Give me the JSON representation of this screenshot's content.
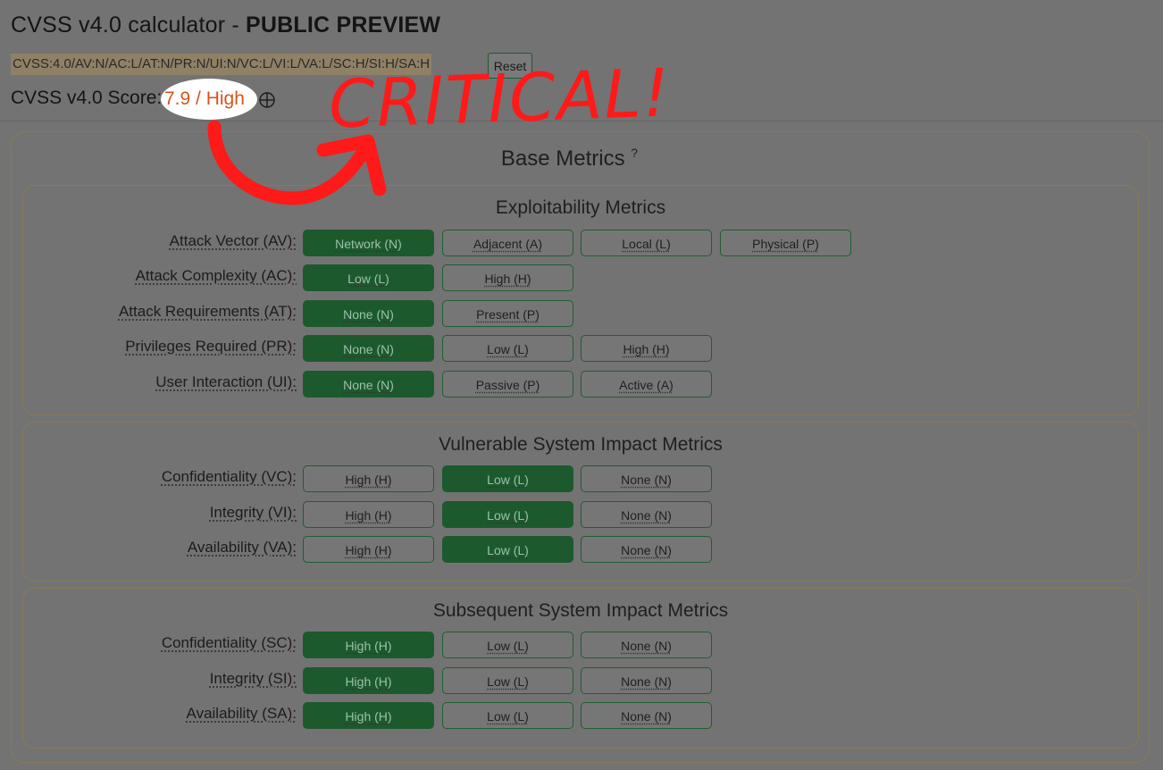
{
  "title": {
    "main": "CVSS v4.0 calculator - ",
    "emphasis": "PUBLIC PREVIEW"
  },
  "vector_string": "CVSS:4.0/AV:N/AC:L/AT:N/PR:N/UI:N/VC:L/VI:L/VA:L/SC:H/SI:H/SA:H",
  "reset_label": "Reset",
  "score": {
    "label": "CVSS v4.0 Score: ",
    "value": "7.9 / High",
    "value_color": "#d6541d"
  },
  "annotation": {
    "text": "CRITICAL!",
    "color": "#ff1a1a",
    "highlight_color": "#ffffff"
  },
  "colors": {
    "selected": "#1c5a2e",
    "overlay_background": "#737373",
    "border": "#8a7a55"
  },
  "base_metrics": {
    "title": "Base Metrics",
    "help": "?",
    "sections": [
      {
        "title": "Exploitability Metrics",
        "metrics": [
          {
            "label": "Attack Vector (AV):",
            "options": [
              "Network (N)",
              "Adjacent (A)",
              "Local (L)",
              "Physical (P)"
            ],
            "selected": 0
          },
          {
            "label": "Attack Complexity (AC):",
            "options": [
              "Low (L)",
              "High (H)"
            ],
            "selected": 0
          },
          {
            "label": "Attack Requirements (AT):",
            "options": [
              "None (N)",
              "Present (P)"
            ],
            "selected": 0
          },
          {
            "label": "Privileges Required (PR):",
            "options": [
              "None (N)",
              "Low (L)",
              "High (H)"
            ],
            "selected": 0
          },
          {
            "label": "User Interaction (UI):",
            "options": [
              "None (N)",
              "Passive (P)",
              "Active (A)"
            ],
            "selected": 0
          }
        ]
      },
      {
        "title": "Vulnerable System Impact Metrics",
        "metrics": [
          {
            "label": "Confidentiality (VC):",
            "options": [
              "High (H)",
              "Low (L)",
              "None (N)"
            ],
            "selected": 1
          },
          {
            "label": "Integrity (VI):",
            "options": [
              "High (H)",
              "Low (L)",
              "None (N)"
            ],
            "selected": 1
          },
          {
            "label": "Availability (VA):",
            "options": [
              "High (H)",
              "Low (L)",
              "None (N)"
            ],
            "selected": 1
          }
        ]
      },
      {
        "title": "Subsequent System Impact Metrics",
        "metrics": [
          {
            "label": "Confidentiality (SC):",
            "options": [
              "High (H)",
              "Low (L)",
              "None (N)"
            ],
            "selected": 0
          },
          {
            "label": "Integrity (SI):",
            "options": [
              "High (H)",
              "Low (L)",
              "None (N)"
            ],
            "selected": 0
          },
          {
            "label": "Availability (SA):",
            "options": [
              "High (H)",
              "Low (L)",
              "None (N)"
            ],
            "selected": 0
          }
        ]
      }
    ]
  }
}
